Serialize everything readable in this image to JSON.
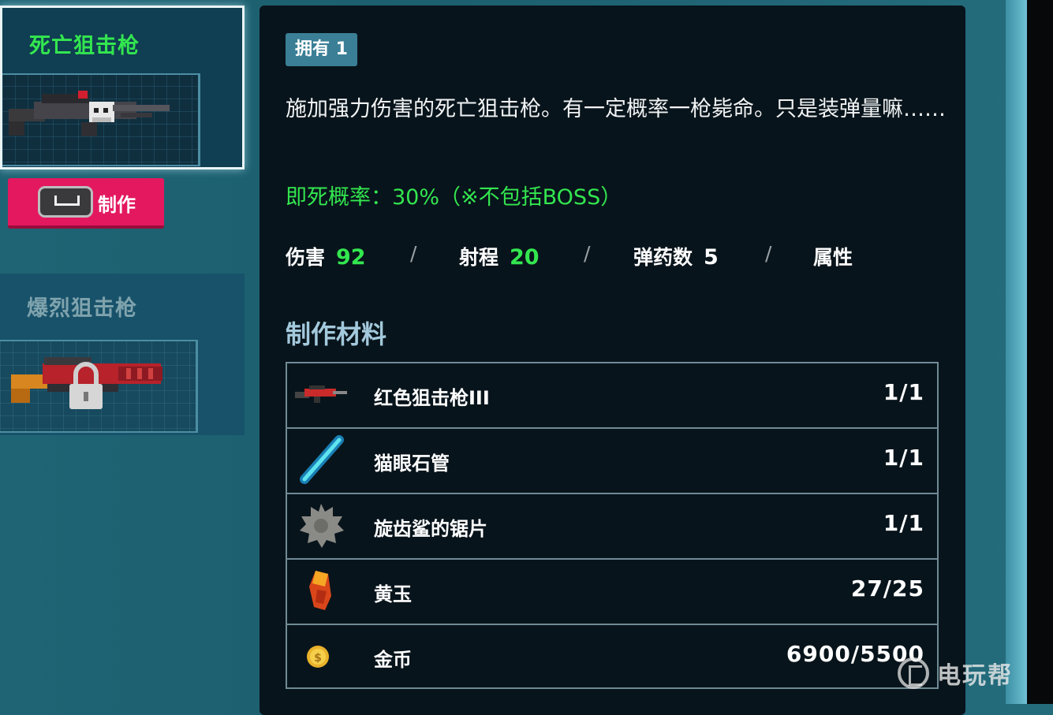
{
  "weapon_list": {
    "active": {
      "name": "死亡狙击枪",
      "icon": "death-sniper-rifle-icon"
    },
    "craft_button": {
      "label": "制作",
      "key_icon": "spacebar-key-icon"
    },
    "locked": {
      "name": "爆烈狙击枪",
      "icon": "burst-sniper-rifle-icon",
      "lock_icon": "padlock-icon"
    }
  },
  "detail": {
    "owned_badge": "拥有 1",
    "description": "施加强力伤害的死亡狙击枪。有一定概率一枪毙命。只是装弹量嘛……",
    "instant_kill": "即死概率：30%（※不包括BOSS）",
    "stats": {
      "damage_label": "伤害",
      "damage_value": "92",
      "range_label": "射程",
      "range_value": "20",
      "ammo_label": "弹药数",
      "ammo_value": "5",
      "attribute_label": "属性",
      "separator": "/"
    },
    "materials_title": "制作材料",
    "materials": [
      {
        "name": "红色狙击枪III",
        "count": "1/1",
        "icon": "red-sniper-rifle-icon"
      },
      {
        "name": "猫眼石管",
        "count": "1/1",
        "icon": "cat-eye-tube-icon"
      },
      {
        "name": "旋齿鲨的锯片",
        "count": "1/1",
        "icon": "saw-blade-icon"
      },
      {
        "name": "黄玉",
        "count": "27/25",
        "icon": "topaz-gem-icon"
      },
      {
        "name": "金币",
        "count": "6900/5500",
        "icon": "gold-coin-icon"
      }
    ]
  },
  "watermark": {
    "text": "电玩帮"
  },
  "colors": {
    "green": "#33e64f",
    "craft_button": "#e3185f",
    "panel": "#08141b",
    "background": "#1f6474"
  }
}
